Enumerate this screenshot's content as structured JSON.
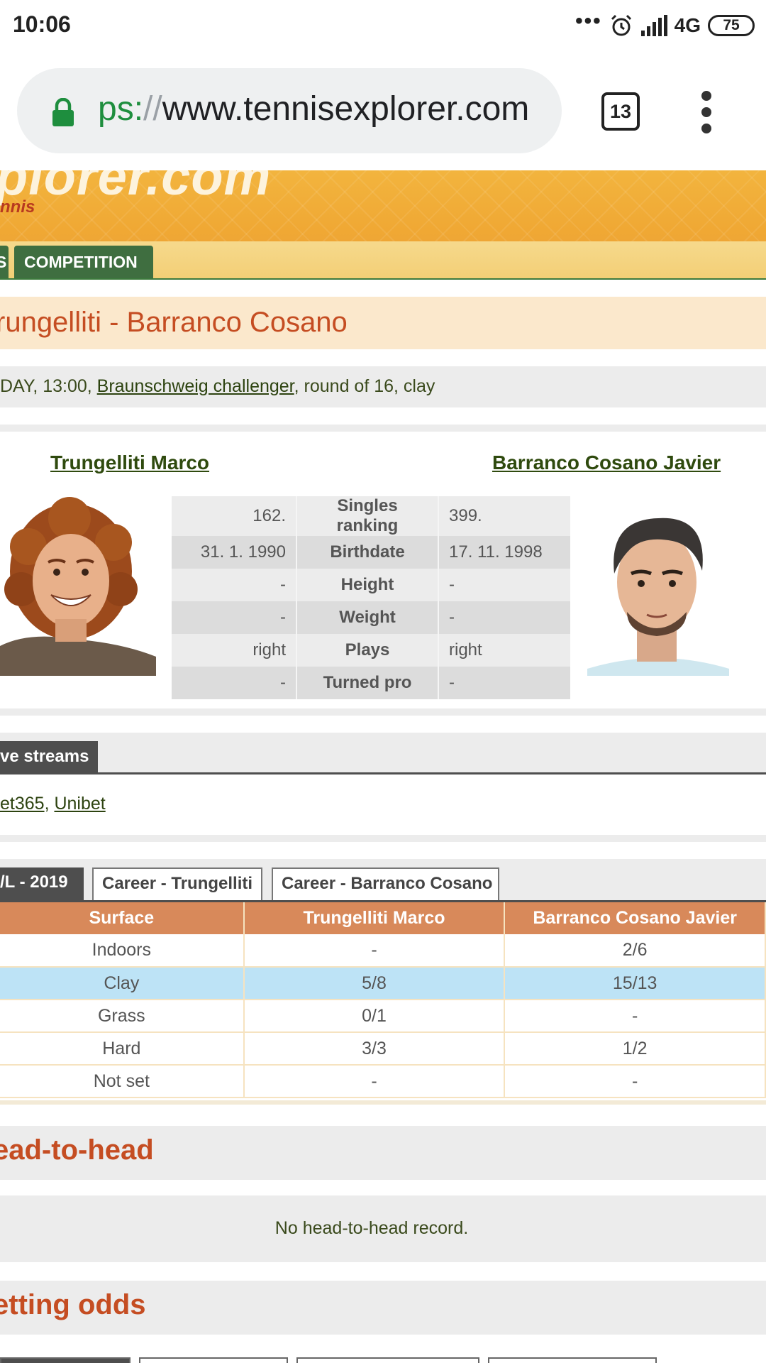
{
  "status_bar": {
    "time": "10:06",
    "network": "4G",
    "battery": "75",
    "icons": [
      "dots-icon",
      "alarm-icon",
      "signal-icon",
      "battery-icon"
    ]
  },
  "browser": {
    "url_scheme": "ps:",
    "url_slashes": "//",
    "url_host": "www.tennisexplorer.com",
    "tab_count": "13",
    "icons": [
      "lock-icon",
      "menu-icon"
    ]
  },
  "site": {
    "logo_main": "plorer.com",
    "logo_sub": "nnis",
    "nav_prev": "S",
    "nav_competition": "COMPETITION"
  },
  "match": {
    "title": "rungelliti - Barranco Cosano",
    "info_prefix": "DAY, 13:00, ",
    "tournament": "Braunschweig challenger",
    "info_suffix": ", round of 16, clay"
  },
  "players": {
    "left_name": "Trungelliti Marco",
    "right_name": "Barranco Cosano Javier"
  },
  "comparison": [
    {
      "left": "162.",
      "label": "Singles ranking",
      "right": "399."
    },
    {
      "left": "31. 1. 1990",
      "label": "Birthdate",
      "right": "17. 11. 1998"
    },
    {
      "left": "-",
      "label": "Height",
      "right": "-"
    },
    {
      "left": "-",
      "label": "Weight",
      "right": "-"
    },
    {
      "left": "right",
      "label": "Plays",
      "right": "right"
    },
    {
      "left": "-",
      "label": "Turned pro",
      "right": "-"
    }
  ],
  "streams": {
    "tab_label": "ve streams",
    "link1": "et365",
    "separator": ", ",
    "link2": "Unibet"
  },
  "stat_tabs": {
    "active": "/L - 2019",
    "career_a": "Career - Trungelliti",
    "career_b": "Career - Barranco Cosano"
  },
  "surface_table": {
    "headers": [
      "Surface",
      "Trungelliti Marco",
      "Barranco Cosano Javier"
    ],
    "rows": [
      [
        "Indoors",
        "-",
        "2/6"
      ],
      [
        "Clay",
        "5/8",
        "15/13"
      ],
      [
        "Grass",
        "0/1",
        "-"
      ],
      [
        "Hard",
        "3/3",
        "1/2"
      ],
      [
        "Not set",
        "-",
        "-"
      ]
    ]
  },
  "h2h": {
    "heading": "ead-to-head",
    "text": "No head-to-head record."
  },
  "odds": {
    "heading": "etting odds"
  },
  "colors": {
    "accent_orange": "#c54d22",
    "header_orange": "#d8895a",
    "highlight_blue": "#bde3f6",
    "nav_green": "#3f6e40"
  }
}
